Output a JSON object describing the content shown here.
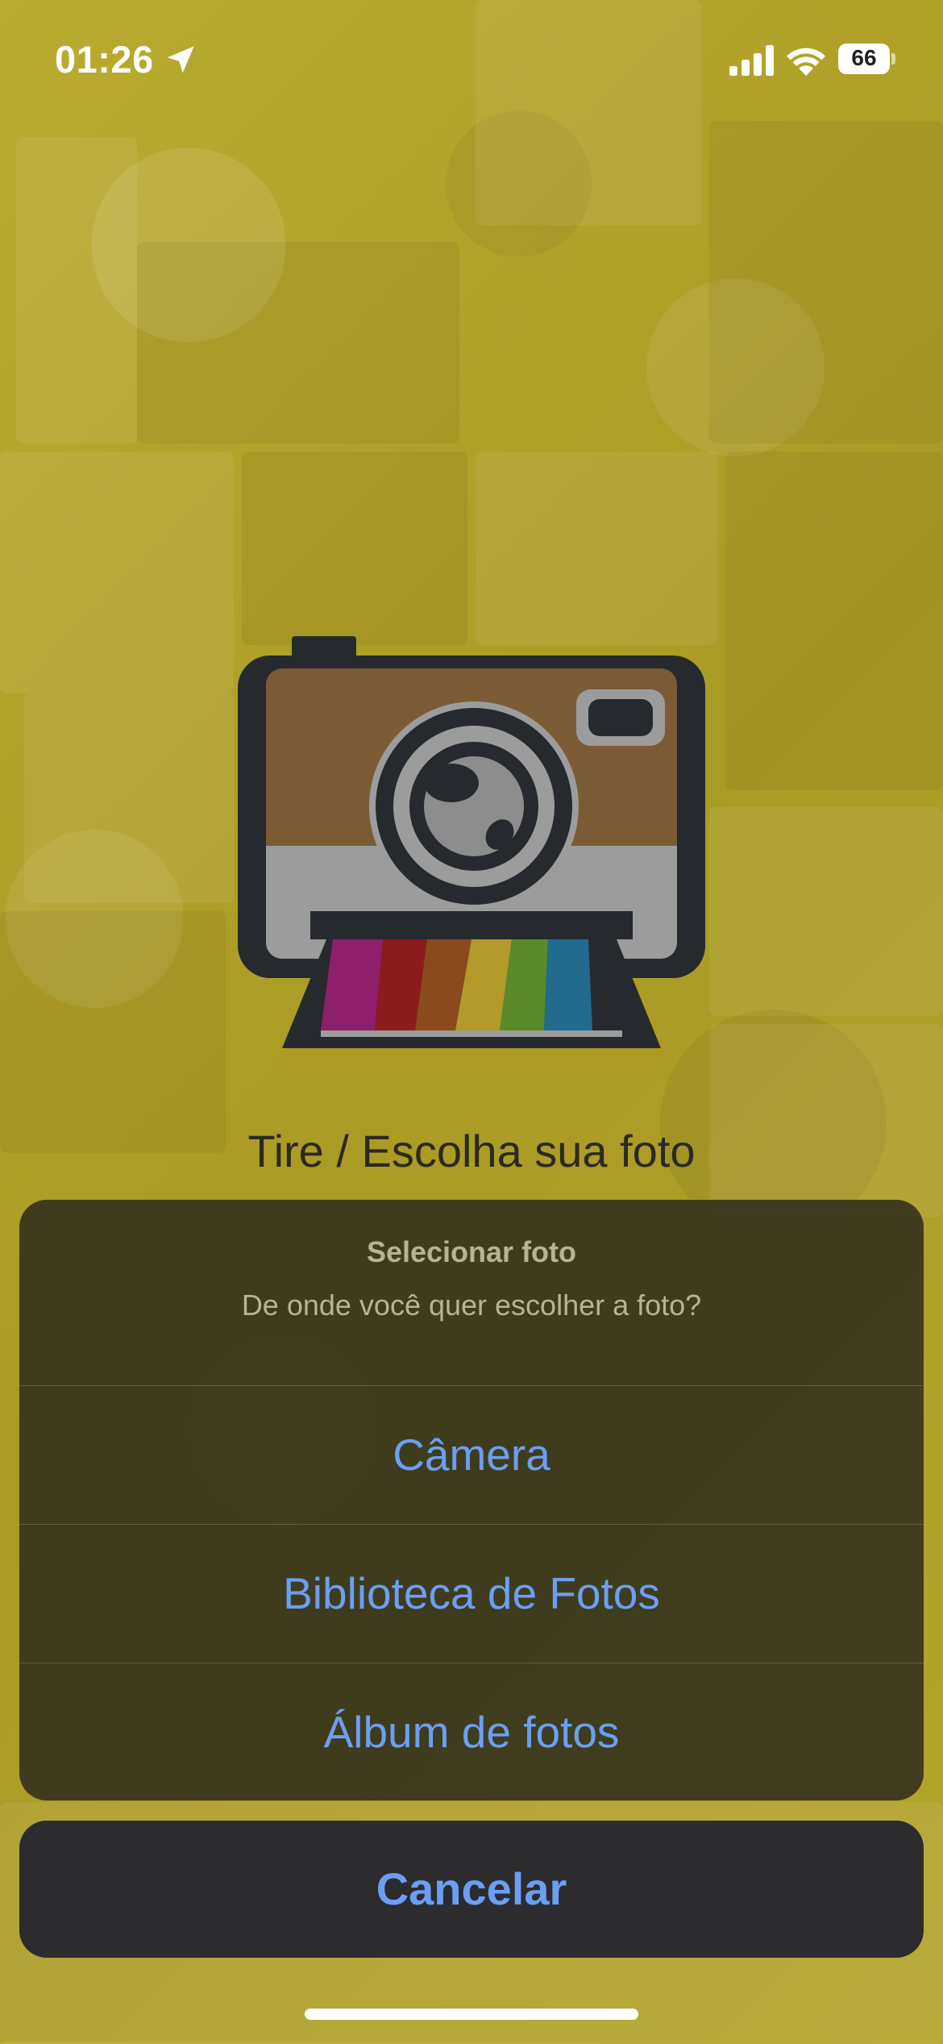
{
  "status_bar": {
    "time": "01:26",
    "battery_level": "66",
    "icons": [
      "location-arrow-icon",
      "cellular-signal-icon",
      "wifi-icon",
      "battery-icon"
    ]
  },
  "screen": {
    "illustration_icon": "polaroid-camera-icon",
    "title": "Tire / Escolha sua foto"
  },
  "action_sheet": {
    "title": "Selecionar foto",
    "message": "De onde você quer escolher a foto?",
    "actions": [
      {
        "label": "Câmera"
      },
      {
        "label": "Biblioteca de Fotos"
      },
      {
        "label": "Álbum de fotos"
      }
    ],
    "cancel_label": "Cancelar"
  },
  "colors": {
    "background": "#b6a72a",
    "sheet_background": "#38361e",
    "action_text": "#6b9ff4",
    "cancel_background": "#2c2c2e"
  }
}
